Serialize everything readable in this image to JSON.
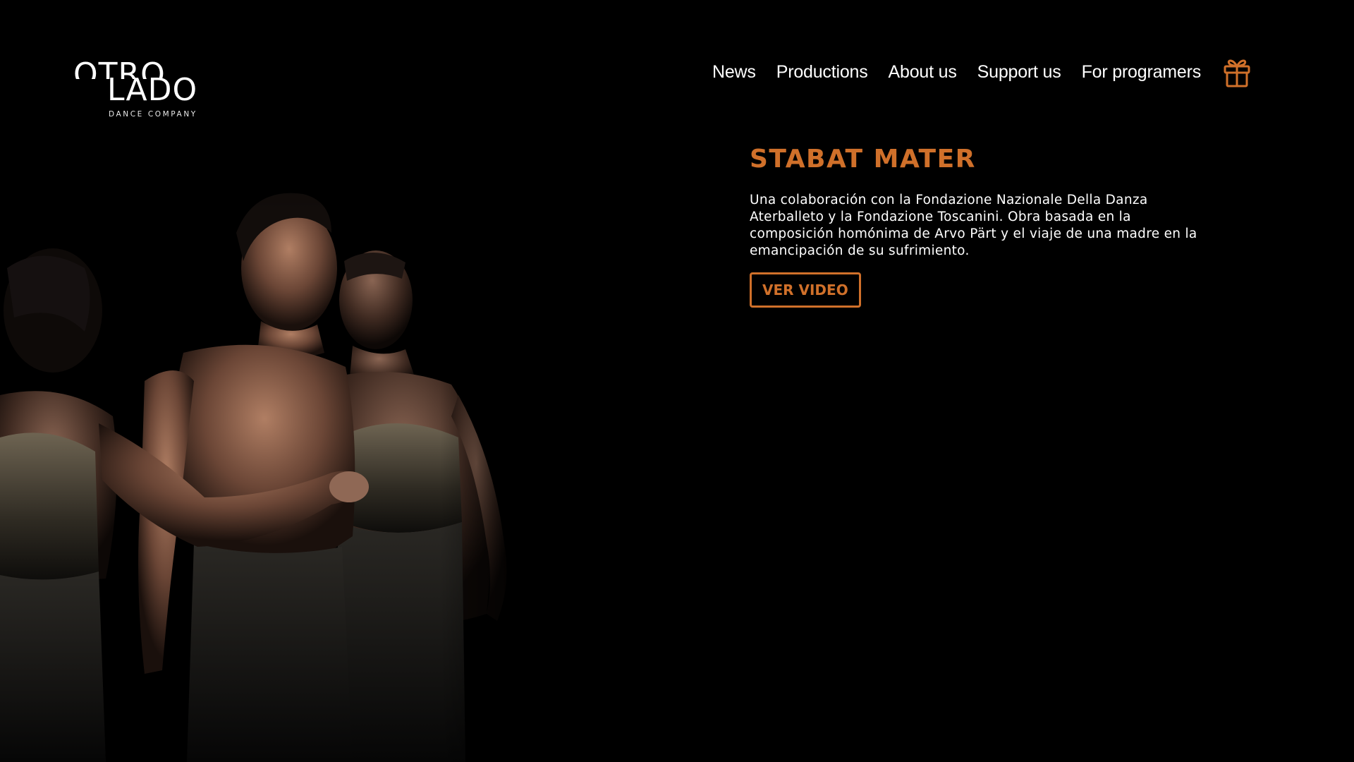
{
  "brand": {
    "logo_top": "OTRO",
    "logo_bottom": "LADO",
    "logo_sub": "DANCE COMPANY"
  },
  "nav": {
    "items": [
      {
        "label": "News"
      },
      {
        "label": "Productions"
      },
      {
        "label": "About us"
      },
      {
        "label": "Support us"
      },
      {
        "label": "For programers"
      }
    ],
    "gift_icon": "gift-icon"
  },
  "feature": {
    "title": "STABAT MATER",
    "description": "Una colaboración con la Fondazione Nazionale Della Danza Aterballeto y la Fondazione Toscanini. Obra basada en la composición homónima de Arvo Pärt y el viaje de una madre en la emancipación de su sufrimiento.",
    "button_label": "VER VIDEO"
  },
  "colors": {
    "background": "#000000",
    "accent": "#d0702a",
    "text": "#ffffff"
  }
}
